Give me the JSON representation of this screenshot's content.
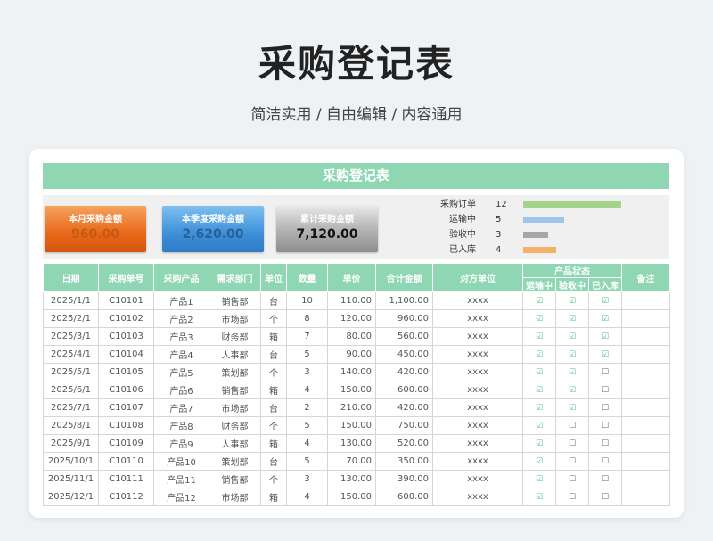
{
  "header": {
    "title": "采购登记表",
    "subtitle": "简洁实用 / 自由编辑 / 内容通用"
  },
  "sheet": {
    "title": "采购登记表",
    "kpis": [
      {
        "label": "本月采购金额",
        "value": "960.00"
      },
      {
        "label": "本季度采购金额",
        "value": "2,620.00"
      },
      {
        "label": "累计采购金额",
        "value": "7,120.00"
      }
    ],
    "stats": [
      {
        "label": "采购订单",
        "value": 12,
        "color": "#a4d48a"
      },
      {
        "label": "运输中",
        "value": 5,
        "color": "#9cc6ea"
      },
      {
        "label": "验收中",
        "value": 3,
        "color": "#a6a6a6"
      },
      {
        "label": "已入库",
        "value": 4,
        "color": "#f5b06a"
      }
    ],
    "columns": [
      "日期",
      "采购单号",
      "采购产品",
      "需求部门",
      "单位",
      "数量",
      "单价",
      "合计金额",
      "对方单位",
      "产品状态",
      "备注"
    ],
    "status_columns": [
      "运输中",
      "验收中",
      "已入库"
    ],
    "checked_symbol": "☑",
    "unchecked_symbol": "☐",
    "rows": [
      {
        "date": "2025/1/1",
        "order": "C10101",
        "product": "产品1",
        "dept": "销售部",
        "unit": "台",
        "qty": "10",
        "price": "110.00",
        "total": "1,100.00",
        "vendor": "xxxx",
        "s": [
          1,
          1,
          1
        ],
        "note": ""
      },
      {
        "date": "2025/2/1",
        "order": "C10102",
        "product": "产品2",
        "dept": "市场部",
        "unit": "个",
        "qty": "8",
        "price": "120.00",
        "total": "960.00",
        "vendor": "xxxx",
        "s": [
          1,
          1,
          1
        ],
        "note": ""
      },
      {
        "date": "2025/3/1",
        "order": "C10103",
        "product": "产品3",
        "dept": "财务部",
        "unit": "箱",
        "qty": "7",
        "price": "80.00",
        "total": "560.00",
        "vendor": "xxxx",
        "s": [
          1,
          1,
          1
        ],
        "note": ""
      },
      {
        "date": "2025/4/1",
        "order": "C10104",
        "product": "产品4",
        "dept": "人事部",
        "unit": "台",
        "qty": "5",
        "price": "90.00",
        "total": "450.00",
        "vendor": "xxxx",
        "s": [
          1,
          1,
          1
        ],
        "note": ""
      },
      {
        "date": "2025/5/1",
        "order": "C10105",
        "product": "产品5",
        "dept": "策划部",
        "unit": "个",
        "qty": "3",
        "price": "140.00",
        "total": "420.00",
        "vendor": "xxxx",
        "s": [
          1,
          1,
          0
        ],
        "note": ""
      },
      {
        "date": "2025/6/1",
        "order": "C10106",
        "product": "产品6",
        "dept": "销售部",
        "unit": "箱",
        "qty": "4",
        "price": "150.00",
        "total": "600.00",
        "vendor": "xxxx",
        "s": [
          1,
          1,
          0
        ],
        "note": ""
      },
      {
        "date": "2025/7/1",
        "order": "C10107",
        "product": "产品7",
        "dept": "市场部",
        "unit": "台",
        "qty": "2",
        "price": "210.00",
        "total": "420.00",
        "vendor": "xxxx",
        "s": [
          1,
          1,
          0
        ],
        "note": ""
      },
      {
        "date": "2025/8/1",
        "order": "C10108",
        "product": "产品8",
        "dept": "财务部",
        "unit": "个",
        "qty": "5",
        "price": "150.00",
        "total": "750.00",
        "vendor": "xxxx",
        "s": [
          1,
          0,
          0
        ],
        "note": ""
      },
      {
        "date": "2025/9/1",
        "order": "C10109",
        "product": "产品9",
        "dept": "人事部",
        "unit": "箱",
        "qty": "4",
        "price": "130.00",
        "total": "520.00",
        "vendor": "xxxx",
        "s": [
          1,
          0,
          0
        ],
        "note": ""
      },
      {
        "date": "2025/10/1",
        "order": "C10110",
        "product": "产品10",
        "dept": "策划部",
        "unit": "台",
        "qty": "5",
        "price": "70.00",
        "total": "350.00",
        "vendor": "xxxx",
        "s": [
          1,
          0,
          0
        ],
        "note": ""
      },
      {
        "date": "2025/11/1",
        "order": "C10111",
        "product": "产品11",
        "dept": "销售部",
        "unit": "个",
        "qty": "3",
        "price": "130.00",
        "total": "390.00",
        "vendor": "xxxx",
        "s": [
          1,
          0,
          0
        ],
        "note": ""
      },
      {
        "date": "2025/12/1",
        "order": "C10112",
        "product": "产品12",
        "dept": "市场部",
        "unit": "箱",
        "qty": "4",
        "price": "150.00",
        "total": "600.00",
        "vendor": "xxxx",
        "s": [
          1,
          0,
          0
        ],
        "note": ""
      }
    ]
  }
}
